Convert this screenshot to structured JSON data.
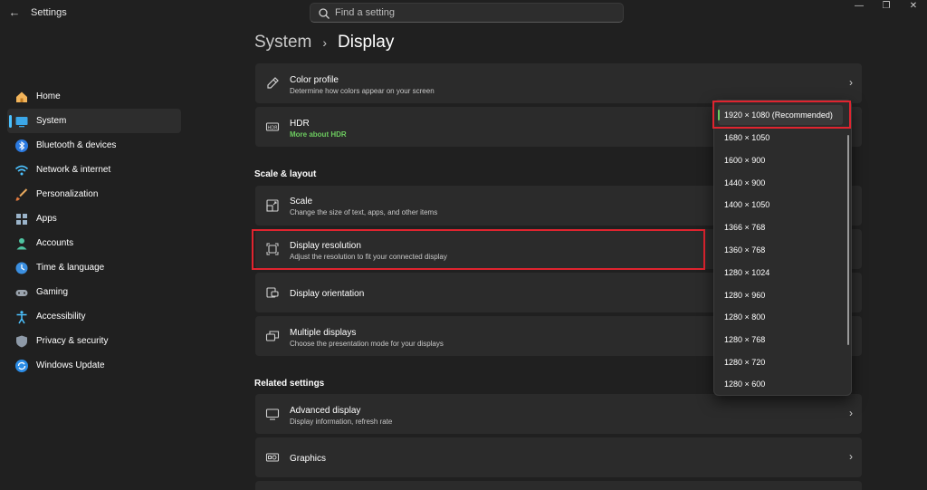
{
  "window": {
    "title": "Settings",
    "back": "←",
    "minimize": "—",
    "restore": "❐",
    "close": "✕"
  },
  "search": {
    "placeholder": "Find a setting"
  },
  "sidebar": {
    "items": [
      {
        "label": "Home"
      },
      {
        "label": "System"
      },
      {
        "label": "Bluetooth & devices"
      },
      {
        "label": "Network & internet"
      },
      {
        "label": "Personalization"
      },
      {
        "label": "Apps"
      },
      {
        "label": "Accounts"
      },
      {
        "label": "Time & language"
      },
      {
        "label": "Gaming"
      },
      {
        "label": "Accessibility"
      },
      {
        "label": "Privacy & security"
      },
      {
        "label": "Windows Update"
      }
    ]
  },
  "breadcrumb": {
    "parent": "System",
    "separator": "›",
    "current": "Display"
  },
  "cards": {
    "color_profile": {
      "title": "Color profile",
      "subtitle": "Determine how colors appear on your screen"
    },
    "hdr": {
      "title": "HDR",
      "link": "More about HDR"
    },
    "scale": {
      "title": "Scale",
      "subtitle": "Change the size of text, apps, and other items"
    },
    "display_resolution": {
      "title": "Display resolution",
      "subtitle": "Adjust the resolution to fit your connected display"
    },
    "display_orientation": {
      "title": "Display orientation"
    },
    "multiple_displays": {
      "title": "Multiple displays",
      "subtitle": "Choose the presentation mode for your displays"
    },
    "advanced_display": {
      "title": "Advanced display",
      "subtitle": "Display information, refresh rate"
    },
    "graphics": {
      "title": "Graphics"
    }
  },
  "sections": {
    "scale_layout": "Scale & layout",
    "related": "Related settings"
  },
  "chevron": "›",
  "resolution_dropdown": {
    "selected_index": 0,
    "options": [
      "1920 × 1080 (Recommended)",
      "1680 × 1050",
      "1600 × 900",
      "1440 × 900",
      "1400 × 1050",
      "1366 × 768",
      "1360 × 768",
      "1280 × 1024",
      "1280 × 960",
      "1280 × 800",
      "1280 × 768",
      "1280 × 720",
      "1280 × 600"
    ]
  },
  "colors": {
    "accent": "#4cc2ff",
    "highlight": "#e0242f",
    "link_green": "#6ccb5f"
  }
}
